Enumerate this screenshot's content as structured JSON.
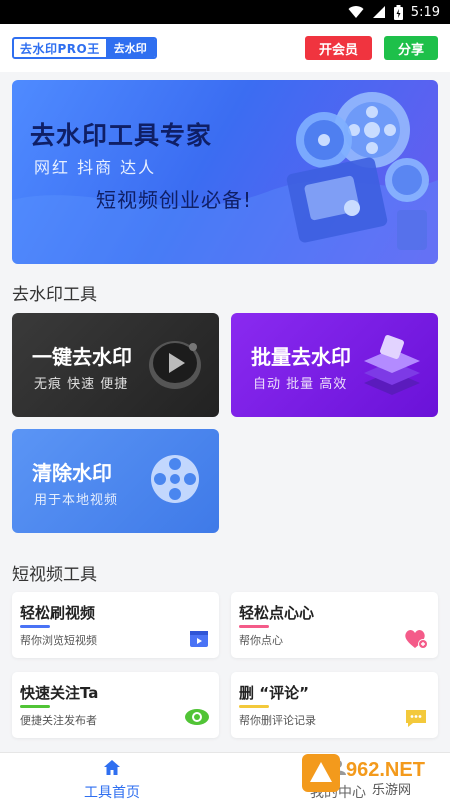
{
  "status_bar": {
    "time": "5:19"
  },
  "header": {
    "logo_text": "去水印PRO王",
    "logo_tag": "去水印",
    "vip_button": "开会员",
    "share_button": "分享"
  },
  "banner": {
    "title": "去水印工具专家",
    "subtitle": "网红 抖商 达人",
    "slogan": "短视频创业必备!"
  },
  "sections": {
    "watermark_tools": "去水印工具",
    "short_video_tools": "短视频工具"
  },
  "cards": [
    {
      "title": "一键去水印",
      "subtitle": "无痕 快速 便捷",
      "color": "#2b2b2b"
    },
    {
      "title": "批量去水印",
      "subtitle": "自动 批量 高效",
      "color": "#7a1fe6"
    },
    {
      "title": "清除水印",
      "subtitle": "用于本地视频",
      "color": "#4a86ef"
    }
  ],
  "tools": [
    {
      "title": "轻松刷视频",
      "subtitle": "帮你浏览短视频",
      "accent": "#4a73f5"
    },
    {
      "title": "轻松点心心",
      "subtitle": "帮你点心",
      "accent": "#f45b89"
    },
    {
      "title": "快速关注Ta",
      "subtitle": "便捷关注发布者",
      "accent": "#51c436"
    },
    {
      "title": "删 “评论”",
      "subtitle": "帮你删评论记录",
      "accent": "#f3c93b"
    }
  ],
  "tabbar": {
    "home": "工具首页",
    "mine": "我的中心"
  },
  "watermark": {
    "brand": "962.NET",
    "sub": "乐游网"
  }
}
